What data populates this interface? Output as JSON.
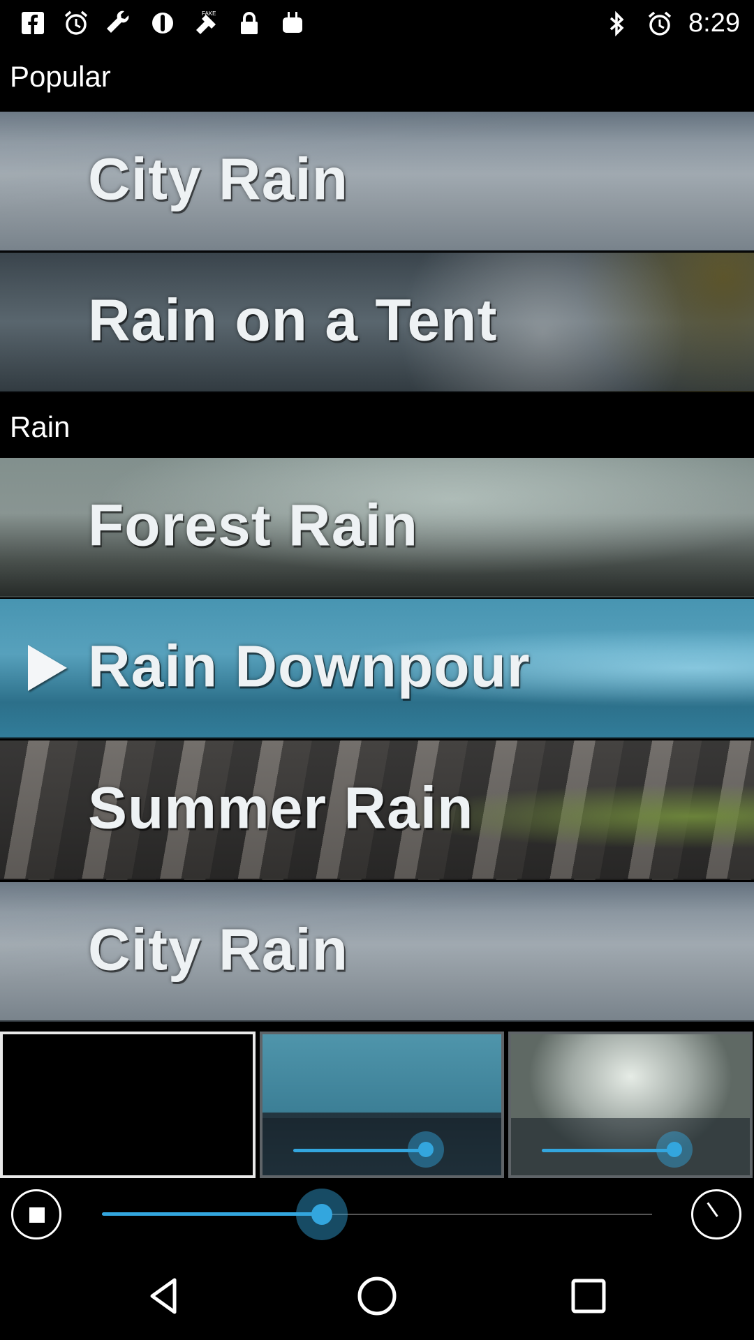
{
  "status_bar": {
    "time": "8:29",
    "left_icons": [
      "facebook-icon",
      "alarm-icon",
      "wrench-icon",
      "compass-icon",
      "fake-gps-icon",
      "lock-icon",
      "android-icon"
    ],
    "right_icons": [
      "bluetooth-icon",
      "alarm-icon"
    ]
  },
  "sections": {
    "popular": {
      "title": "Popular"
    },
    "rain": {
      "title": "Rain"
    }
  },
  "tiles": [
    {
      "label": "City Rain",
      "section": "Popular"
    },
    {
      "label": "Rain on a Tent",
      "section": "Popular"
    },
    {
      "label": "Forest Rain",
      "section": "Rain"
    },
    {
      "label": "Rain Downpour",
      "section": "Rain",
      "playing": true
    },
    {
      "label": "Summer Rain",
      "section": "Rain"
    },
    {
      "label": "City Rain",
      "section": "Rain"
    }
  ],
  "mixer": {
    "slots": [
      {
        "state": "empty"
      },
      {
        "state": "filled",
        "theme": "water",
        "volume": 0.92
      },
      {
        "state": "filled",
        "theme": "storm",
        "volume": 0.92
      }
    ]
  },
  "controls": {
    "stop_icon": "stop-icon",
    "timer_icon": "timer-icon",
    "master_volume": 0.4
  },
  "nav_bar": {
    "icons": [
      "back-icon",
      "home-icon",
      "recents-icon"
    ]
  },
  "colors": {
    "accent": "#33a6de",
    "background": "#000000"
  }
}
